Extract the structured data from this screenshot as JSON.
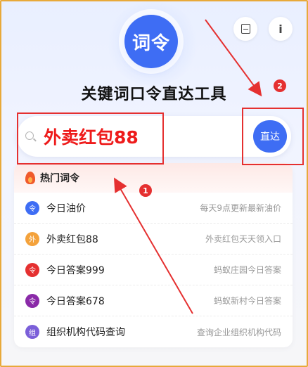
{
  "logo": {
    "text": "词令"
  },
  "header": {
    "info_label": "i",
    "save_icon": "save-icon"
  },
  "page": {
    "title": "关键词口令直达工具"
  },
  "search": {
    "value": "外卖红包88",
    "go_label": "直达"
  },
  "callouts": {
    "badge1": "1",
    "badge2": "2"
  },
  "hot": {
    "title": "热门词令",
    "items": [
      {
        "icon_text": "令",
        "color": "#3e6df4",
        "label": "今日油价",
        "hint": "每天9点更新最新油价"
      },
      {
        "icon_text": "外",
        "color": "#f4a23b",
        "label": "外卖红包88",
        "hint": "外卖红包天天领入口"
      },
      {
        "icon_text": "令",
        "color": "#e53030",
        "label": "今日答案999",
        "hint": "蚂蚁庄园今日答案"
      },
      {
        "icon_text": "令",
        "color": "#8a2aa8",
        "label": "今日答案678",
        "hint": "蚂蚁新村今日答案"
      },
      {
        "icon_text": "组",
        "color": "#7b5fd9",
        "label": "组织机构代码查询",
        "hint": "查询企业组织机构代码"
      }
    ]
  },
  "colors": {
    "accent": "#3e6df4",
    "annotation": "#e53030"
  }
}
